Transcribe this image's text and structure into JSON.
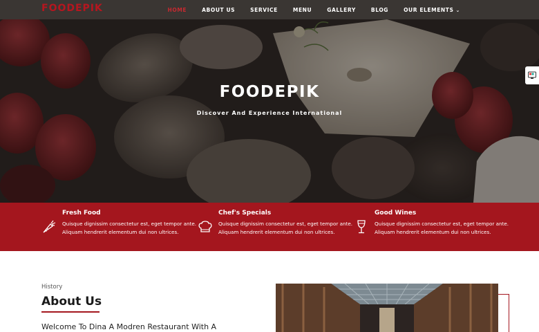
{
  "brand": {
    "logo": "FOODEPIK",
    "accent": "#a4161e"
  },
  "nav": {
    "items": [
      {
        "label": "HOME",
        "active": true
      },
      {
        "label": "ABOUT US"
      },
      {
        "label": "SERVICE"
      },
      {
        "label": "MENU"
      },
      {
        "label": "GALLERY"
      },
      {
        "label": "BLOG"
      },
      {
        "label": "OUR ELEMENTS",
        "dropdown_icon": "chevron-down-icon"
      }
    ]
  },
  "hero": {
    "title": "FOODEPIK",
    "subtitle": "Discover And Experience International"
  },
  "features": [
    {
      "icon": "carrot-icon",
      "title": "Fresh Food",
      "text": "Quisque dignissim consectetur est, eget tempor ante. Aliquam hendrerit elementum dui non ultrices."
    },
    {
      "icon": "chef-hat-icon",
      "title": "Chef's Specials",
      "text": "Quisque dignissim consectetur est, eget tempor ante. Aliquam hendrerit elementum dui non ultrices."
    },
    {
      "icon": "wine-glass-icon",
      "title": "Good Wines",
      "text": "Quisque dignissim consectetur est, eget tempor ante. Aliquam hendrerit elementum dui non ultrices."
    }
  ],
  "about": {
    "eyebrow": "History",
    "heading": "About Us",
    "welcome": "Welcome To Dina A Modren Restaurant With A"
  }
}
